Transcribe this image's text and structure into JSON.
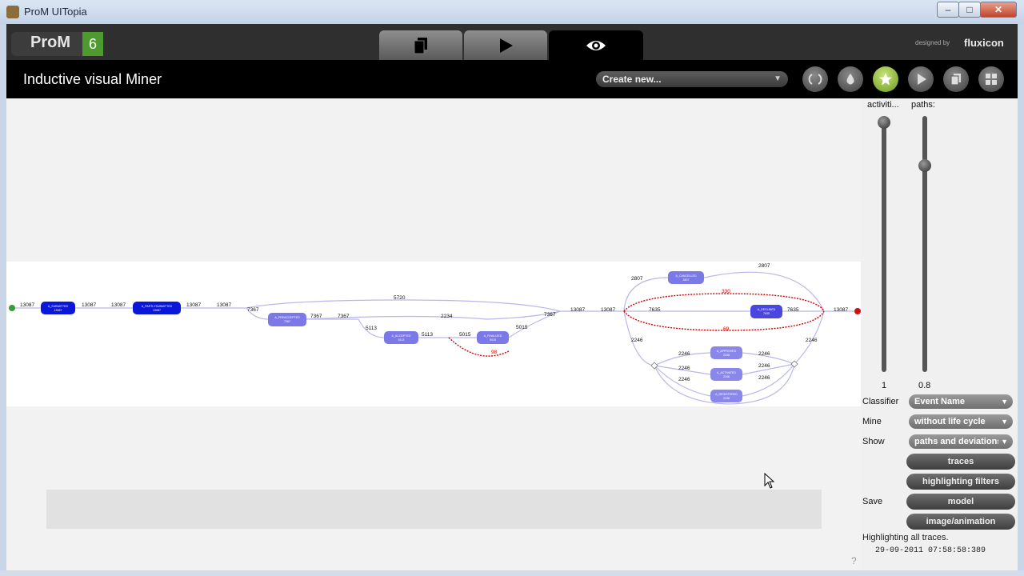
{
  "window": {
    "title": "ProM UITopia",
    "min": "–",
    "max": "□",
    "close": "✕"
  },
  "header": {
    "logo_text": "ProM",
    "logo_version": "6",
    "designed_by": "designed by",
    "brand": "fluxicon",
    "tabs": [
      "workspace",
      "actions",
      "views"
    ],
    "active_tab": "views"
  },
  "toolbar": {
    "view_title": "Inductive visual Miner",
    "create_new": "Create new...",
    "icons": [
      "refresh-icon",
      "drop-icon",
      "star-icon",
      "play-icon",
      "copy-icon",
      "grid-icon"
    ]
  },
  "sliders": {
    "activities_label": "activiti...",
    "paths_label": "paths:",
    "activities_value": "1",
    "paths_value": "0.8",
    "activities_level": 1.0,
    "paths_level": 0.8
  },
  "controls": {
    "classifier_label": "Classifier",
    "classifier_value": "Event Name",
    "mine_label": "Mine",
    "mine_value": "without life cycle",
    "show_label": "Show",
    "show_value": "paths and deviations",
    "traces_button": "traces",
    "filters_button": "highlighting filters",
    "save_label": "Save",
    "model_button": "model",
    "image_button": "image/animation"
  },
  "status": {
    "highlighting": "Highlighting all traces.",
    "timestamp": "29-09-2011 07:58:58:389",
    "help": "?"
  },
  "model": {
    "nodes": [
      {
        "label": "A_SUBMITTED",
        "count": "13087",
        "color": "#0a16d8"
      },
      {
        "label": "A_PARTLYSUBMITTED",
        "count": "13087",
        "color": "#0a16d8"
      },
      {
        "label": "A_PREACCEPTED",
        "count": "7367",
        "color": "#7b78e8"
      },
      {
        "label": "A_ACCEPTED",
        "count": "5113",
        "color": "#7b78e8"
      },
      {
        "label": "A_FINALIZED",
        "count": "5015",
        "color": "#7b78e8"
      },
      {
        "label": "A_CANCELLED",
        "count": "2807",
        "color": "#7b78e8"
      },
      {
        "label": "A_DECLINED",
        "count": "7635",
        "color": "#4a46e0"
      },
      {
        "label": "A_APPROVED",
        "count": "2246",
        "color": "#8a87ea"
      },
      {
        "label": "A_ACTIVATED",
        "count": "2246",
        "color": "#8a87ea"
      },
      {
        "label": "A_REGISTERED",
        "count": "2246",
        "color": "#8a87ea"
      }
    ],
    "edge_labels": [
      "13087",
      "13087",
      "13087",
      "13087",
      "13087",
      "7367",
      "5720",
      "7367",
      "7367",
      "2234",
      "5113",
      "5113",
      "5015",
      "5015",
      "98",
      "7367",
      "13087",
      "13087",
      "2807",
      "2807",
      "330",
      "7635",
      "7635",
      "69",
      "13087",
      "2246",
      "2246",
      "2246",
      "2246",
      "2246",
      "2246",
      "2246",
      "2246"
    ],
    "deviation_labels": [
      "98",
      "330",
      "69"
    ],
    "colors": {
      "start": "#3b9a3b",
      "end": "#cc1111",
      "deviation": "#d40000",
      "edge": "#b9b7e8"
    }
  }
}
